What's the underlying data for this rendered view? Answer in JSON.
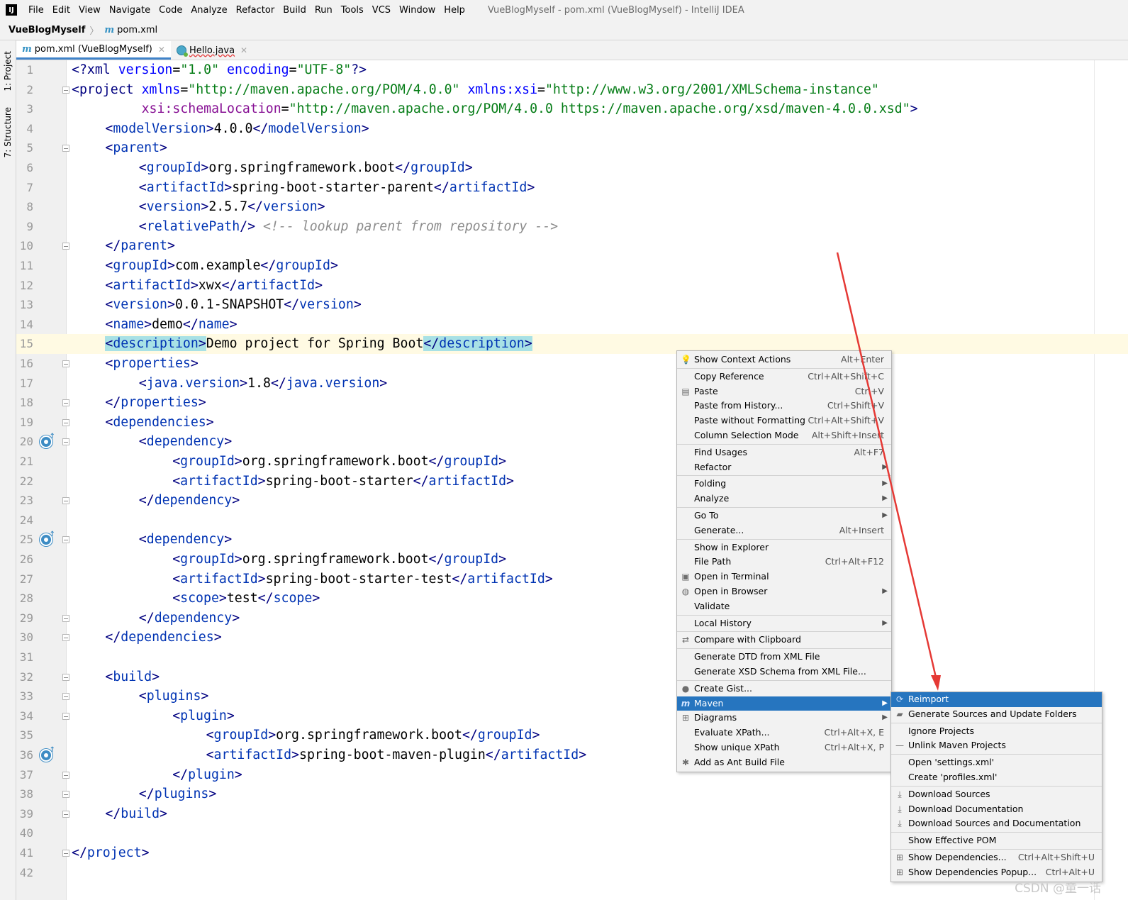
{
  "menubar": {
    "logo": "IJ",
    "items": [
      "File",
      "Edit",
      "View",
      "Navigate",
      "Code",
      "Analyze",
      "Refactor",
      "Build",
      "Run",
      "Tools",
      "VCS",
      "Window",
      "Help"
    ],
    "window_title": "VueBlogMyself - pom.xml (VueBlogMyself) - IntelliJ IDEA"
  },
  "navbar": {
    "project": "VueBlogMyself",
    "file": "pom.xml"
  },
  "toolstrip": {
    "project_tab": "1: Project",
    "structure_tab": "7: Structure"
  },
  "tabs": [
    {
      "label": "pom.xml (VueBlogMyself)",
      "icon": "maven-icon",
      "active": true
    },
    {
      "label": "Hello.java",
      "icon": "java-class-icon",
      "active": false
    }
  ],
  "editor": {
    "current_line": 15,
    "lines": [
      {
        "n": "1"
      },
      {
        "n": "2"
      },
      {
        "n": "3"
      },
      {
        "n": "4"
      },
      {
        "n": "5"
      },
      {
        "n": "6"
      },
      {
        "n": "7"
      },
      {
        "n": "8"
      },
      {
        "n": "9"
      },
      {
        "n": "10"
      },
      {
        "n": "11"
      },
      {
        "n": "12"
      },
      {
        "n": "13"
      },
      {
        "n": "14"
      },
      {
        "n": "15"
      },
      {
        "n": "16"
      },
      {
        "n": "17"
      },
      {
        "n": "18"
      },
      {
        "n": "19"
      },
      {
        "n": "20"
      },
      {
        "n": "21"
      },
      {
        "n": "22"
      },
      {
        "n": "23"
      },
      {
        "n": "24"
      },
      {
        "n": "25"
      },
      {
        "n": "26"
      },
      {
        "n": "27"
      },
      {
        "n": "28"
      },
      {
        "n": "29"
      },
      {
        "n": "30"
      },
      {
        "n": "31"
      },
      {
        "n": "32"
      },
      {
        "n": "33"
      },
      {
        "n": "34"
      },
      {
        "n": "35"
      },
      {
        "n": "36"
      },
      {
        "n": "37"
      },
      {
        "n": "38"
      },
      {
        "n": "39"
      },
      {
        "n": "40"
      },
      {
        "n": "41"
      },
      {
        "n": "42"
      }
    ],
    "code": {
      "l1": {
        "a": "<?xml ",
        "b": "version",
        "c": "=",
        "d": "\"1.0\"",
        "e": " ",
        "f": "encoding",
        "g": "=",
        "h": "\"UTF-8\"",
        "i": "?>"
      },
      "l2": {
        "a": "<project ",
        "b": "xmlns",
        "c": "=",
        "d": "\"http://maven.apache.org/POM/4.0.0\"",
        "e": " ",
        "f": "xmlns:xsi",
        "g": "=",
        "h": "\"http://www.w3.org/2001/XMLSchema-instance\""
      },
      "l3": {
        "a": "         ",
        "b": "xsi:schemaLocation",
        "c": "=",
        "d": "\"http://maven.apache.org/POM/4.0.0 https://maven.apache.org/xsd/maven-4.0.0.xsd\"",
        "e": ">"
      },
      "l4": {
        "open": "modelVersion",
        "text": "4.0.0",
        "close": "modelVersion"
      },
      "l5": {
        "open": "parent"
      },
      "l6": {
        "open": "groupId",
        "text": "org.springframework.boot",
        "close": "groupId"
      },
      "l7": {
        "open": "artifactId",
        "text": "spring-boot-starter-parent",
        "close": "artifactId"
      },
      "l8": {
        "open": "version",
        "text": "2.5.7",
        "close": "version"
      },
      "l9": {
        "selfclose": "relativePath",
        "comment": "<!-- lookup parent from repository -->"
      },
      "l10": {
        "close": "parent"
      },
      "l11": {
        "open": "groupId",
        "text": "com.example",
        "close": "groupId"
      },
      "l12": {
        "open": "artifactId",
        "text": "xwx",
        "close": "artifactId"
      },
      "l13": {
        "open": "version",
        "text": "0.0.1-SNAPSHOT",
        "close": "version"
      },
      "l14": {
        "open": "name",
        "text": "demo",
        "close": "name"
      },
      "l15": {
        "open": "description",
        "text": "Demo project for Spring Boot",
        "close": "description"
      },
      "l16": {
        "open": "properties"
      },
      "l17": {
        "open": "java.version",
        "text": "1.8",
        "close": "java.version"
      },
      "l18": {
        "close": "properties"
      },
      "l19": {
        "open": "dependencies"
      },
      "l20": {
        "open": "dependency"
      },
      "l21": {
        "open": "groupId",
        "text": "org.springframework.boot",
        "close": "groupId"
      },
      "l22": {
        "open": "artifactId",
        "text": "spring-boot-starter",
        "close": "artifactId"
      },
      "l23": {
        "close": "dependency"
      },
      "l25": {
        "open": "dependency"
      },
      "l26": {
        "open": "groupId",
        "text": "org.springframework.boot",
        "close": "groupId"
      },
      "l27": {
        "open": "artifactId",
        "text": "spring-boot-starter-test",
        "close": "artifactId"
      },
      "l28": {
        "open": "scope",
        "text": "test",
        "close": "scope"
      },
      "l29": {
        "close": "dependency"
      },
      "l30": {
        "close": "dependencies"
      },
      "l32": {
        "open": "build"
      },
      "l33": {
        "open": "plugins"
      },
      "l34": {
        "open": "plugin"
      },
      "l35": {
        "open": "groupId",
        "text": "org.springframework.boot",
        "close": "groupId"
      },
      "l36": {
        "open": "artifactId",
        "text": "spring-boot-maven-plugin",
        "close": "artifactId"
      },
      "l37": {
        "close": "plugin"
      },
      "l38": {
        "close": "plugins"
      },
      "l39": {
        "close": "build"
      },
      "l41": {
        "close": "project"
      }
    }
  },
  "context_menu": {
    "items": [
      {
        "label": "Show Context Actions",
        "shortcut": "Alt+Enter",
        "icon": "lightbulb-icon"
      },
      {
        "label": "Copy Reference",
        "shortcut": "Ctrl+Alt+Shift+C"
      },
      {
        "label": "Paste",
        "shortcut": "Ctrl+V",
        "icon": "clipboard-icon"
      },
      {
        "label": "Paste from History...",
        "shortcut": "Ctrl+Shift+V"
      },
      {
        "label": "Paste without Formatting",
        "shortcut": "Ctrl+Alt+Shift+V"
      },
      {
        "label": "Column Selection Mode",
        "shortcut": "Alt+Shift+Insert"
      },
      {
        "label": "Find Usages",
        "shortcut": "Alt+F7"
      },
      {
        "label": "Refactor",
        "submenu": true
      },
      {
        "label": "Folding",
        "submenu": true
      },
      {
        "label": "Analyze",
        "submenu": true
      },
      {
        "label": "Go To",
        "submenu": true
      },
      {
        "label": "Generate...",
        "shortcut": "Alt+Insert"
      },
      {
        "label": "Show in Explorer"
      },
      {
        "label": "File Path",
        "shortcut": "Ctrl+Alt+F12"
      },
      {
        "label": "Open in Terminal",
        "icon": "terminal-icon"
      },
      {
        "label": "Open in Browser",
        "submenu": true,
        "icon": "globe-icon"
      },
      {
        "label": "Validate"
      },
      {
        "label": "Local History",
        "submenu": true
      },
      {
        "label": "Compare with Clipboard",
        "icon": "compare-icon"
      },
      {
        "label": "Generate DTD from XML File"
      },
      {
        "label": "Generate XSD Schema from XML File..."
      },
      {
        "label": "Create Gist...",
        "icon": "github-icon"
      },
      {
        "label": "Maven",
        "submenu": true,
        "icon": "maven-icon",
        "selected": true
      },
      {
        "label": "Diagrams",
        "submenu": true,
        "icon": "diagram-icon"
      },
      {
        "label": "Evaluate XPath...",
        "shortcut": "Ctrl+Alt+X, E"
      },
      {
        "label": "Show unique XPath",
        "shortcut": "Ctrl+Alt+X, P"
      },
      {
        "label": "Add as Ant Build File",
        "icon": "ant-icon"
      }
    ]
  },
  "maven_submenu": {
    "items": [
      {
        "label": "Reimport",
        "icon": "reimport-icon",
        "selected": true
      },
      {
        "label": "Generate Sources and Update Folders",
        "icon": "generate-folders-icon"
      },
      {
        "label": "Ignore Projects"
      },
      {
        "label": "Unlink Maven Projects",
        "icon": "minus-icon"
      },
      {
        "label": "Open 'settings.xml'"
      },
      {
        "label": "Create 'profiles.xml'"
      },
      {
        "label": "Download Sources",
        "icon": "download-icon"
      },
      {
        "label": "Download Documentation",
        "icon": "download-icon"
      },
      {
        "label": "Download Sources and Documentation",
        "icon": "download-icon"
      },
      {
        "label": "Show Effective POM"
      },
      {
        "label": "Show Dependencies...",
        "shortcut": "Ctrl+Alt+Shift+U",
        "icon": "dependencies-icon"
      },
      {
        "label": "Show Dependencies Popup...",
        "shortcut": "Ctrl+Alt+U",
        "icon": "dependencies-icon"
      }
    ]
  },
  "watermark": "CSDN @童一话",
  "colors": {
    "accent": "#2675bf",
    "annotation_arrow": "#e53935",
    "tag": "#000080",
    "string": "#067d17"
  }
}
